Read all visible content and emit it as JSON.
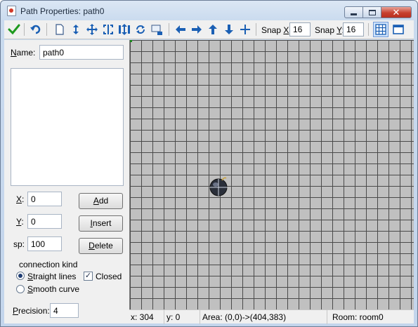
{
  "window": {
    "title": "Path Properties: path0",
    "close_glyph": "✕"
  },
  "toolbar": {
    "icons": [
      "ok-checkmark-icon",
      "undo-icon",
      "clear-path-icon",
      "reverse-path-icon",
      "shift-path-icon",
      "mirror-horizontal-icon",
      "flip-vertical-icon",
      "rotate-path-icon",
      "scale-path-icon",
      "shift-left-icon",
      "shift-right-icon",
      "shift-up-icon",
      "shift-down-icon",
      "center-path-icon",
      "toggle-grid-icon",
      "room-view-icon"
    ],
    "snap_x_label_pre": "Snap ",
    "snap_x_label_key": "X",
    "snap_x_label_post": ":",
    "snap_x_value": "16",
    "snap_y_label_pre": "Snap ",
    "snap_y_label_key": "Y",
    "snap_y_label_post": ":",
    "snap_y_value": "16",
    "accent_color": "#1a5fb4"
  },
  "panel": {
    "name_label_key": "N",
    "name_label_rest": "ame:",
    "name_value": "path0",
    "x_label_key": "X",
    "x_label_rest": ":",
    "x_value": "0",
    "y_label_key": "Y",
    "y_label_rest": ":",
    "y_value": "0",
    "sp_label": "sp:",
    "sp_value": "100",
    "add_key": "A",
    "add_rest": "dd",
    "insert_key": "I",
    "insert_rest": "nsert",
    "delete_key": "D",
    "delete_rest": "elete",
    "connection_kind_label": "connection kind",
    "straight_key": "S",
    "straight_rest": "traight lines",
    "straight_selected": true,
    "smooth_key": "S",
    "smooth_rest": "mooth curve",
    "closed_label": "Closed",
    "closed_checked": true,
    "check_glyph": "✓",
    "precision_key": "P",
    "precision_rest": "recision:",
    "precision_value": "4"
  },
  "canvas": {
    "grid_color": "#4a4a4a",
    "background_color": "#c0c0c0",
    "object_icon": "bomb-icon"
  },
  "status": {
    "x": "x: 304",
    "y": "y: 0",
    "area": "Area: (0,0)->(404,383)",
    "room": "Room: room0"
  }
}
